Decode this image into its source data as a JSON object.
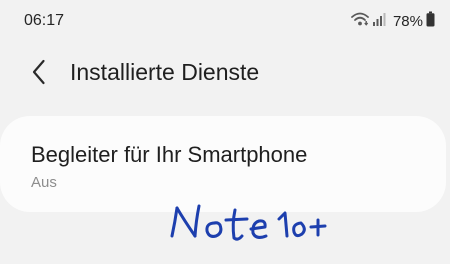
{
  "status_bar": {
    "time": "06:17",
    "battery": "78%",
    "icons": [
      "wifi-icon",
      "signal-icon",
      "battery-icon"
    ]
  },
  "header": {
    "title": "Installierte Dienste",
    "back_icon": "chevron-left-icon"
  },
  "services": [
    {
      "title": "Begleiter für Ihr Smartphone",
      "status": "Aus"
    }
  ],
  "annotation": {
    "text": "Note 10+"
  },
  "colors": {
    "background": "#f2f2f2",
    "card": "#fcfcfc",
    "primary_text": "#1f1f1f",
    "secondary_text": "#8d8d8d",
    "ink": "#1d3fae"
  }
}
